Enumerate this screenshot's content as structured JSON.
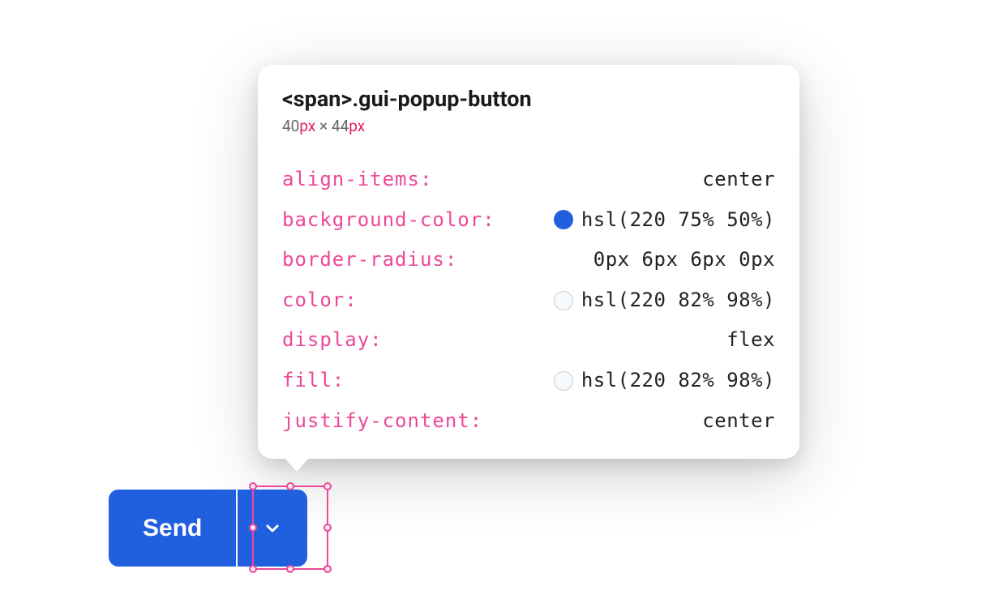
{
  "tooltip": {
    "selector_tag": "<span>",
    "selector_class": ".gui-popup-button",
    "dimensions": {
      "width_value": "40",
      "width_unit": "px",
      "separator": " × ",
      "height_value": "44",
      "height_unit": "px"
    },
    "properties": [
      {
        "name": "align-items:",
        "value": "center",
        "swatch": null
      },
      {
        "name": "background-color:",
        "value": "hsl(220 75% 50%)",
        "swatch": "blue"
      },
      {
        "name": "border-radius:",
        "value": "0px 6px 6px 0px",
        "swatch": null
      },
      {
        "name": "color:",
        "value": "hsl(220 82% 98%)",
        "swatch": "light"
      },
      {
        "name": "display:",
        "value": "flex",
        "swatch": null
      },
      {
        "name": "fill:",
        "value": "hsl(220 82% 98%)",
        "swatch": "light"
      },
      {
        "name": "justify-content:",
        "value": "center",
        "swatch": null
      }
    ]
  },
  "buttons": {
    "send_label": "Send"
  },
  "colors": {
    "accent_blue": "hsl(220 75% 50%)",
    "text_on_blue": "hsl(220 82% 98%)",
    "selection_pink": "#ec4899"
  }
}
